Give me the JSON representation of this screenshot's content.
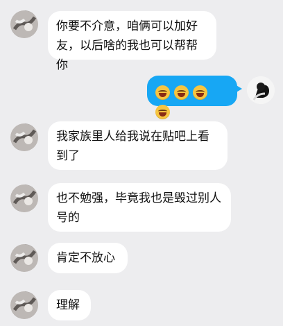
{
  "messages": [
    {
      "side": "left",
      "text": "你要不介意，咱俩可以加好友，以后啥的我也可以帮帮你"
    },
    {
      "side": "right",
      "emoji": "😂",
      "emoji_count": 4
    },
    {
      "side": "left",
      "text": "我家族里人给我说在贴吧上看到了"
    },
    {
      "side": "left",
      "text": "也不勉强，毕竟我也是毁过别人号的"
    },
    {
      "side": "left",
      "text": "肯定不放心"
    },
    {
      "side": "left",
      "text": "理解"
    }
  ],
  "colors": {
    "background": "#ededef",
    "bubble_in": "#ffffff",
    "bubble_out": "#17a7f4"
  },
  "icons": {
    "contact_avatar": "cat-avatar",
    "self_avatar": "person-avatar",
    "emoji": "tears-of-joy-emoji"
  }
}
